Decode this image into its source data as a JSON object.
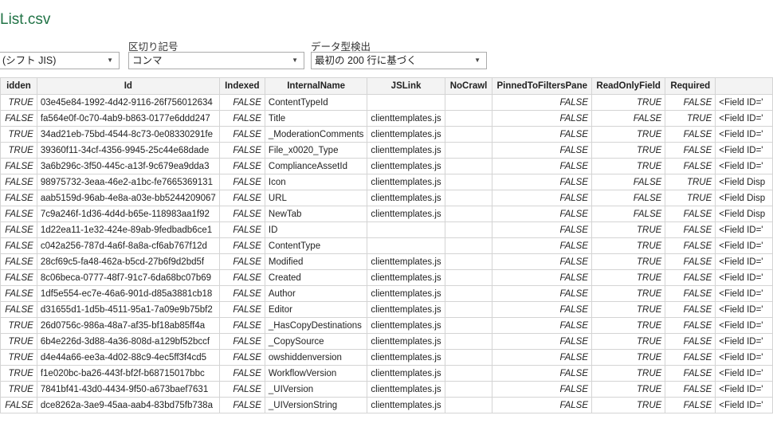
{
  "title": "List.csv",
  "options": {
    "encoding_label": "",
    "encoding_value": "(シフト JIS)",
    "delimiter_label": "区切り記号",
    "delimiter_value": "コンマ",
    "detect_label": "データ型検出",
    "detect_value": "最初の 200 行に基づく"
  },
  "table": {
    "headers": [
      "idden",
      "Id",
      "Indexed",
      "InternalName",
      "JSLink",
      "NoCrawl",
      "PinnedToFiltersPane",
      "ReadOnlyField",
      "Required",
      ""
    ],
    "rows": [
      [
        "TRUE",
        "03e45e84-1992-4d42-9116-26f756012634",
        "FALSE",
        "ContentTypeId",
        "",
        "",
        "FALSE",
        "TRUE",
        "FALSE",
        "<Field ID='"
      ],
      [
        "FALSE",
        "fa564e0f-0c70-4ab9-b863-0177e6ddd247",
        "FALSE",
        "Title",
        "clienttemplates.js",
        "",
        "FALSE",
        "FALSE",
        "TRUE",
        "<Field ID='"
      ],
      [
        "TRUE",
        "34ad21eb-75bd-4544-8c73-0e08330291fe",
        "FALSE",
        "_ModerationComments",
        "clienttemplates.js",
        "",
        "FALSE",
        "TRUE",
        "FALSE",
        "<Field ID='"
      ],
      [
        "TRUE",
        "39360f11-34cf-4356-9945-25c44e68dade",
        "FALSE",
        "File_x0020_Type",
        "clienttemplates.js",
        "",
        "FALSE",
        "TRUE",
        "FALSE",
        "<Field ID='"
      ],
      [
        "FALSE",
        "3a6b296c-3f50-445c-a13f-9c679ea9dda3",
        "FALSE",
        "ComplianceAssetId",
        "clienttemplates.js",
        "",
        "FALSE",
        "TRUE",
        "FALSE",
        "<Field ID='"
      ],
      [
        "FALSE",
        "98975732-3eaa-46e2-a1bc-fe7665369131",
        "FALSE",
        "Icon",
        "clienttemplates.js",
        "",
        "FALSE",
        "FALSE",
        "TRUE",
        "<Field Disp"
      ],
      [
        "FALSE",
        "aab5159d-96ab-4e8a-a03e-bb5244209067",
        "FALSE",
        "URL",
        "clienttemplates.js",
        "",
        "FALSE",
        "FALSE",
        "TRUE",
        "<Field Disp"
      ],
      [
        "FALSE",
        "7c9a246f-1d36-4d4d-b65e-118983aa1f92",
        "FALSE",
        "NewTab",
        "clienttemplates.js",
        "",
        "FALSE",
        "FALSE",
        "FALSE",
        "<Field Disp"
      ],
      [
        "FALSE",
        "1d22ea11-1e32-424e-89ab-9fedbadb6ce1",
        "FALSE",
        "ID",
        "",
        "",
        "FALSE",
        "TRUE",
        "FALSE",
        "<Field ID='"
      ],
      [
        "FALSE",
        "c042a256-787d-4a6f-8a8a-cf6ab767f12d",
        "FALSE",
        "ContentType",
        "",
        "",
        "FALSE",
        "TRUE",
        "FALSE",
        "<Field ID='"
      ],
      [
        "FALSE",
        "28cf69c5-fa48-462a-b5cd-27b6f9d2bd5f",
        "FALSE",
        "Modified",
        "clienttemplates.js",
        "",
        "FALSE",
        "TRUE",
        "FALSE",
        "<Field ID='"
      ],
      [
        "FALSE",
        "8c06beca-0777-48f7-91c7-6da68bc07b69",
        "FALSE",
        "Created",
        "clienttemplates.js",
        "",
        "FALSE",
        "TRUE",
        "FALSE",
        "<Field ID='"
      ],
      [
        "FALSE",
        "1df5e554-ec7e-46a6-901d-d85a3881cb18",
        "FALSE",
        "Author",
        "clienttemplates.js",
        "",
        "FALSE",
        "TRUE",
        "FALSE",
        "<Field ID='"
      ],
      [
        "FALSE",
        "d31655d1-1d5b-4511-95a1-7a09e9b75bf2",
        "FALSE",
        "Editor",
        "clienttemplates.js",
        "",
        "FALSE",
        "TRUE",
        "FALSE",
        "<Field ID='"
      ],
      [
        "TRUE",
        "26d0756c-986a-48a7-af35-bf18ab85ff4a",
        "FALSE",
        "_HasCopyDestinations",
        "clienttemplates.js",
        "",
        "FALSE",
        "TRUE",
        "FALSE",
        "<Field ID='"
      ],
      [
        "TRUE",
        "6b4e226d-3d88-4a36-808d-a129bf52bccf",
        "FALSE",
        "_CopySource",
        "clienttemplates.js",
        "",
        "FALSE",
        "TRUE",
        "FALSE",
        "<Field ID='"
      ],
      [
        "TRUE",
        "d4e44a66-ee3a-4d02-88c9-4ec5ff3f4cd5",
        "FALSE",
        "owshiddenversion",
        "clienttemplates.js",
        "",
        "FALSE",
        "TRUE",
        "FALSE",
        "<Field ID='"
      ],
      [
        "TRUE",
        "f1e020bc-ba26-443f-bf2f-b68715017bbc",
        "FALSE",
        "WorkflowVersion",
        "clienttemplates.js",
        "",
        "FALSE",
        "TRUE",
        "FALSE",
        "<Field ID='"
      ],
      [
        "TRUE",
        "7841bf41-43d0-4434-9f50-a673baef7631",
        "FALSE",
        "_UIVersion",
        "clienttemplates.js",
        "",
        "FALSE",
        "TRUE",
        "FALSE",
        "<Field ID='"
      ],
      [
        "FALSE",
        "dce8262a-3ae9-45aa-aab4-83bd75fb738a",
        "FALSE",
        "_UIVersionString",
        "clienttemplates.js",
        "",
        "FALSE",
        "TRUE",
        "FALSE",
        "<Field ID='"
      ]
    ]
  }
}
